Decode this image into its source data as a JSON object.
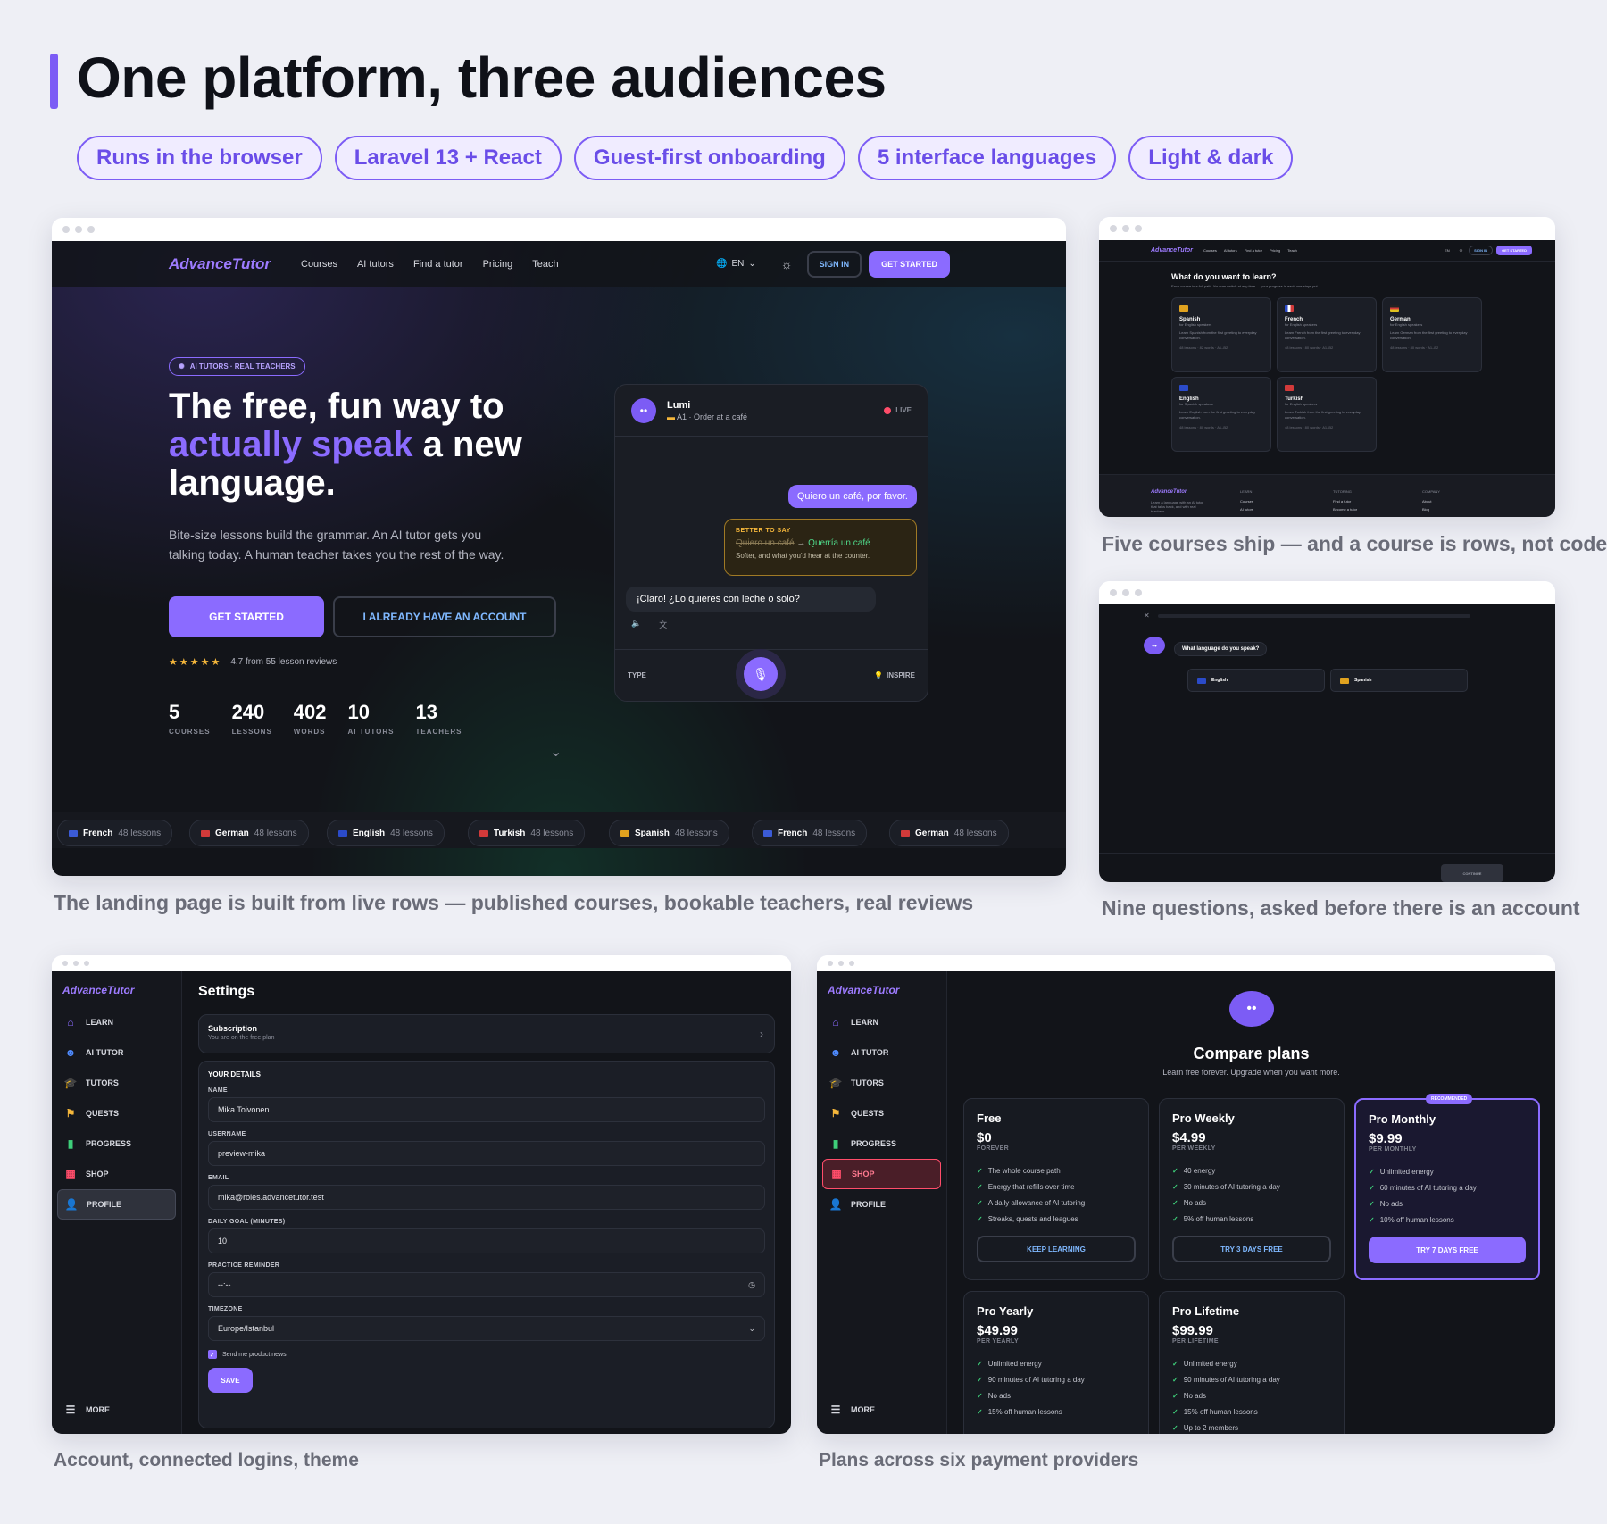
{
  "header": {
    "title": "One platform, three audiences",
    "chips": [
      "Runs in the browser",
      "Laravel 13 + React",
      "Guest-first onboarding",
      "5 interface languages",
      "Light & dark"
    ]
  },
  "captions": {
    "landing": "The landing page is built from live rows — published courses, bookable teachers, real reviews",
    "courses": "Five courses ship — and a course is rows, not code",
    "onboarding": "Nine questions, asked before there is an account",
    "settings": "Account, connected logins, theme",
    "plans": "Plans across six payment providers"
  },
  "landing": {
    "logo": "AdvanceTutor",
    "nav": [
      "Courses",
      "AI tutors",
      "Find a tutor",
      "Pricing",
      "Teach"
    ],
    "lang": "EN",
    "sign_in": "SIGN IN",
    "get_started": "GET STARTED",
    "badge": "AI TUTORS · REAL TEACHERS",
    "headline_1": "The free, fun way to",
    "headline_hl": "actually speak",
    "headline_2": " a new",
    "headline_3": "language.",
    "subtext": "Bite-size lessons build the grammar. An AI tutor gets you talking today. A human teacher takes you the rest of the way.",
    "cta_primary": "GET STARTED",
    "cta_secondary": "I ALREADY HAVE AN ACCOUNT",
    "stars": "★★★★★",
    "rating": "4.7 from 55 lesson reviews",
    "rating_value": 4.7,
    "stats": [
      {
        "n": "5",
        "l": "COURSES"
      },
      {
        "n": "240",
        "l": "LESSONS"
      },
      {
        "n": "402",
        "l": "WORDS"
      },
      {
        "n": "10",
        "l": "AI TUTORS"
      },
      {
        "n": "13",
        "l": "TEACHERS"
      }
    ],
    "chat": {
      "name": "Lumi",
      "level": "A1 · Order at a café",
      "live": "LIVE",
      "user_msg": "Quiero un café, por favor.",
      "better_label": "BETTER TO SAY",
      "better_old": "Quiero un café",
      "better_new": "Querría un café",
      "better_note": "Softer, and what you'd hear at the counter.",
      "bot_msg": "¡Claro! ¿Lo quieres con leche o solo?",
      "type": "TYPE",
      "inspire": "INSPIRE"
    },
    "ticker": [
      {
        "name": "French",
        "count": "48 lessons"
      },
      {
        "name": "German",
        "count": "48 lessons"
      },
      {
        "name": "English",
        "count": "48 lessons"
      },
      {
        "name": "Turkish",
        "count": "48 lessons"
      },
      {
        "name": "Spanish",
        "count": "48 lessons"
      },
      {
        "name": "French",
        "count": "48 lessons"
      },
      {
        "name": "German",
        "count": "48 lessons"
      }
    ]
  },
  "courses_win": {
    "logo": "AdvanceTutor",
    "nav": [
      "Courses",
      "AI tutors",
      "Find a tutor",
      "Pricing",
      "Teach"
    ],
    "lang": "EN",
    "sign_in": "SIGN IN",
    "get_started": "GET STARTED",
    "heading": "What do you want to learn?",
    "sub": "Each course is a full path. You can switch at any time — your progress in each one stays put.",
    "courses": [
      {
        "name": "Spanish",
        "for": "for English speakers",
        "desc": "Learn Spanish from the first greeting to everyday conversation.",
        "stats": "48 lessons · 82 words · A1–B2"
      },
      {
        "name": "French",
        "for": "for English speakers",
        "desc": "Learn French from the first greeting to everyday conversation.",
        "stats": "48 lessons · 80 words · A1–B2"
      },
      {
        "name": "German",
        "for": "for English speakers",
        "desc": "Learn German from the first greeting to everyday conversation.",
        "stats": "48 lessons · 80 words · A1–B2"
      },
      {
        "name": "English",
        "for": "for Spanish speakers",
        "desc": "Learn English from the first greeting to everyday conversation.",
        "stats": "48 lessons · 80 words · A1–B2"
      },
      {
        "name": "Turkish",
        "for": "for English speakers",
        "desc": "Learn Turkish from the first greeting to everyday conversation.",
        "stats": "48 lessons · 80 words · A1–B2"
      }
    ],
    "footer": {
      "logo": "AdvanceTutor",
      "tagline": "Learn a language with an AI tutor that talks back, and with real teachers.",
      "cols": [
        {
          "h": "LEARN",
          "items": [
            "Courses",
            "AI tutors"
          ]
        },
        {
          "h": "TUTORING",
          "items": [
            "Find a tutor",
            "Become a tutor"
          ]
        },
        {
          "h": "COMPANY",
          "items": [
            "About",
            "Blog"
          ]
        }
      ]
    }
  },
  "onboarding": {
    "question": "What language do you speak?",
    "options": [
      "English",
      "Spanish"
    ],
    "continue": "CONTINUE"
  },
  "settings": {
    "logo": "AdvanceTutor",
    "sidebar": [
      "LEARN",
      "AI TUTOR",
      "TUTORS",
      "QUESTS",
      "PROGRESS",
      "SHOP",
      "PROFILE"
    ],
    "more": "MORE",
    "title": "Settings",
    "subscription": "Subscription",
    "subscription_sub": "You are on the free plan",
    "details": "YOUR DETAILS",
    "fields": [
      {
        "label": "NAME",
        "value": "Mika Toivonen"
      },
      {
        "label": "USERNAME",
        "value": "preview-mika"
      },
      {
        "label": "EMAIL",
        "value": "mika@roles.advancetutor.test"
      },
      {
        "label": "DAILY GOAL (MINUTES)",
        "value": "10"
      },
      {
        "label": "PRACTICE REMINDER",
        "value": "--:--"
      },
      {
        "label": "TIMEZONE",
        "value": "Europe/Istanbul"
      }
    ],
    "news": "Send me product news",
    "save": "SAVE"
  },
  "plans": {
    "logo": "AdvanceTutor",
    "sidebar": [
      "LEARN",
      "AI TUTOR",
      "TUTORS",
      "QUESTS",
      "PROGRESS",
      "SHOP",
      "PROFILE"
    ],
    "more": "MORE",
    "title": "Compare plans",
    "subtitle": "Learn free forever. Upgrade when you want more.",
    "recommended": "RECOMMENDED",
    "items": [
      {
        "name": "Free",
        "price": "$0",
        "per": "FOREVER",
        "features": [
          "The whole course path",
          "Energy that refills over time",
          "A daily allowance of AI tutoring",
          "Streaks, quests and leagues"
        ],
        "cta": "KEEP LEARNING"
      },
      {
        "name": "Pro Weekly",
        "price": "$4.99",
        "per": "PER WEEKLY",
        "features": [
          "40 energy",
          "30 minutes of AI tutoring a day",
          "No ads",
          "5% off human lessons"
        ],
        "cta": "TRY 3 DAYS FREE"
      },
      {
        "name": "Pro Monthly",
        "price": "$9.99",
        "per": "PER MONTHLY",
        "features": [
          "Unlimited energy",
          "60 minutes of AI tutoring a day",
          "No ads",
          "10% off human lessons"
        ],
        "cta": "TRY 7 DAYS FREE"
      },
      {
        "name": "Pro Yearly",
        "price": "$49.99",
        "per": "PER YEARLY",
        "features": [
          "Unlimited energy",
          "90 minutes of AI tutoring a day",
          "No ads",
          "15% off human lessons"
        ]
      },
      {
        "name": "Pro Lifetime",
        "price": "$99.99",
        "per": "PER LIFETIME",
        "features": [
          "Unlimited energy",
          "90 minutes of AI tutoring a day",
          "No ads",
          "15% off human lessons",
          "Up to 2 members"
        ]
      }
    ]
  },
  "colors": {
    "accent": "#8b6bff",
    "bg": "#121419",
    "page": "#eeeff5"
  }
}
